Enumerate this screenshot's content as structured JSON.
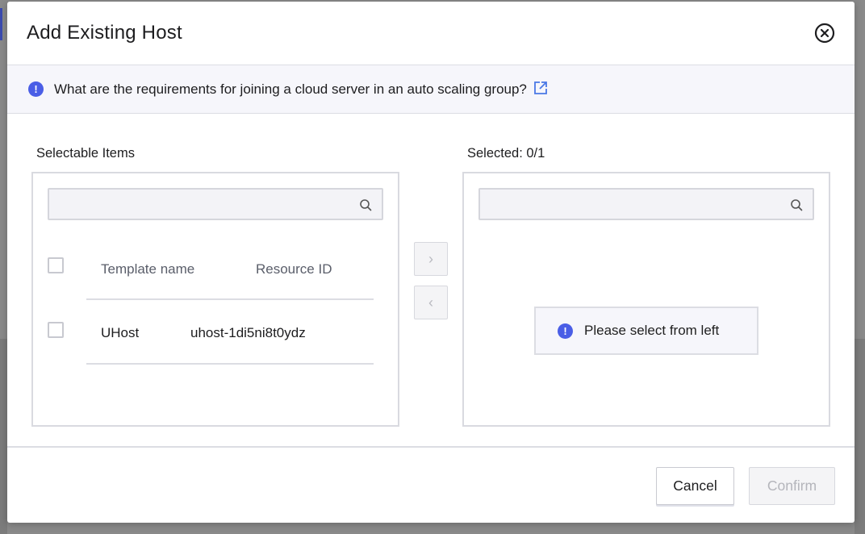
{
  "dialog": {
    "title": "Add Existing Host"
  },
  "notice": {
    "text": "What are the requirements for joining a cloud server in an auto scaling group?"
  },
  "left_panel": {
    "label": "Selectable Items",
    "search_value": "",
    "columns": [
      "Template name",
      "Resource ID"
    ],
    "rows": [
      {
        "name": "UHost",
        "resource_id": "uhost-1di5ni8t0ydz"
      }
    ]
  },
  "right_panel": {
    "label": "Selected: 0/1",
    "search_value": "",
    "empty_text": "Please select from left"
  },
  "transfer": {
    "move_right": "›",
    "move_left": "‹"
  },
  "footer": {
    "cancel_label": "Cancel",
    "confirm_label": "Confirm"
  },
  "colors": {
    "accent": "#4a5ee6",
    "border": "#d9dae0",
    "disabled_text": "#b4b5bb"
  },
  "icons": {
    "close": "close-circle-icon",
    "info": "info-icon",
    "external_link": "external-link-icon",
    "search": "search-icon"
  }
}
